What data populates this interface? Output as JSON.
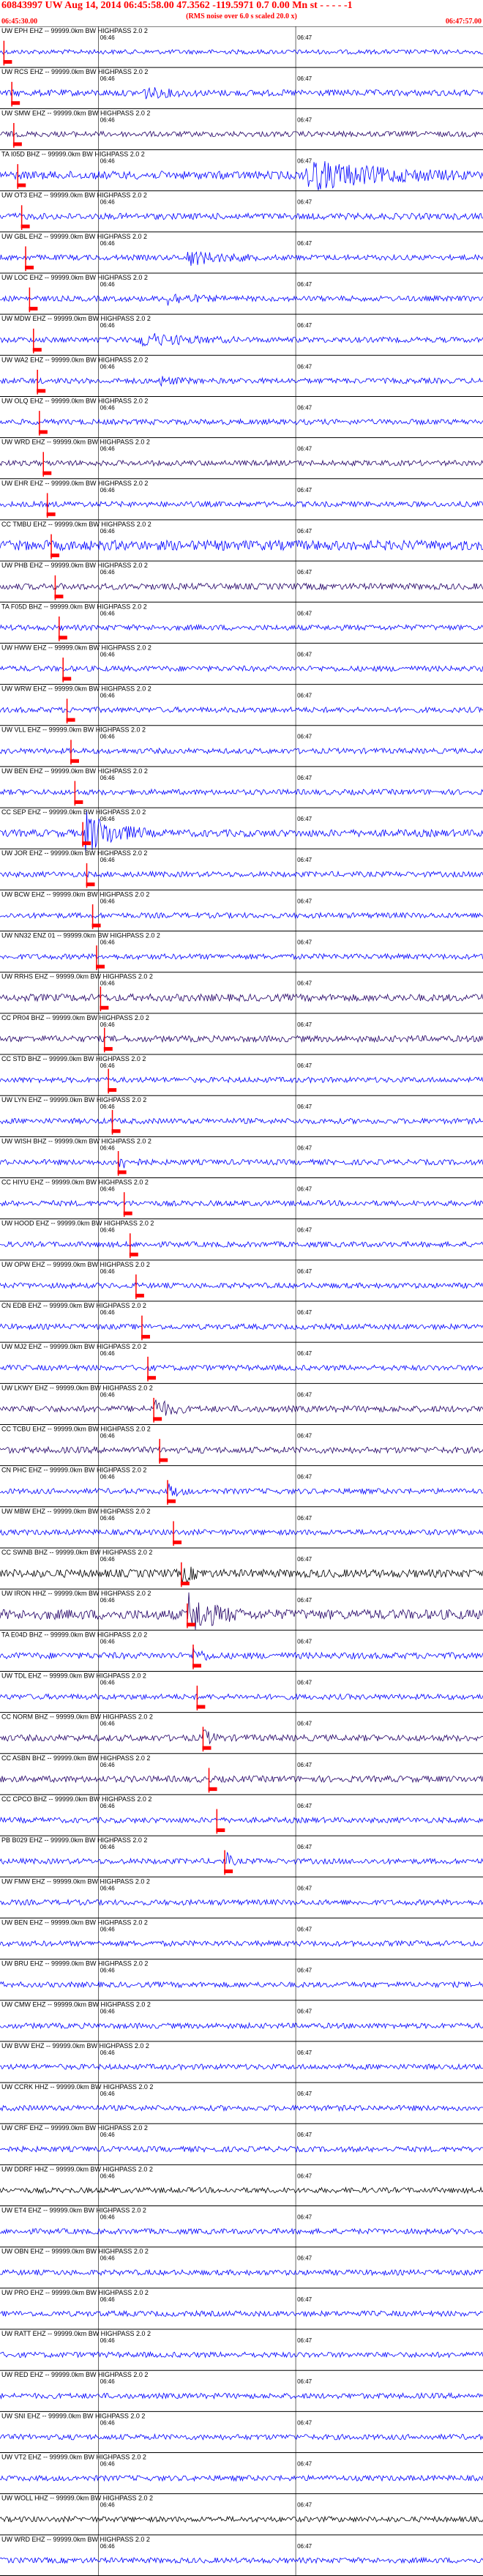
{
  "header": {
    "title": "60843997 UW Aug 14, 2014 06:45:58.00   47.3562  -119.5971   0.7  0.00  Mn st  - - - -  -1",
    "subtitle": "(RMS noise over 6.0 s scaled 20.0 x)",
    "start_time": "06:45:30.00",
    "end_time": "06:47:57.00"
  },
  "colors": {
    "accent": "#ff0000",
    "blue": "#0000ff",
    "dark": "#220066",
    "black": "#000000"
  },
  "chart_data": {
    "type": "line",
    "title": "60843997 UW Aug 14, 2014 06:45:58.00   47.3562  -119.5971   0.7  0.00  Mn st  - - - -  -1",
    "time_range": [
      "06:45:30.00",
      "06:47:57.00"
    ],
    "tick_labels": [
      "06:46",
      "06:47"
    ],
    "tick_minutes": [
      0.5,
      1.5
    ],
    "grid": true,
    "filter_label": "99999.0km BW HIGHPASS 2.0 2",
    "series": [
      {
        "name": "UW EPH EHZ",
        "label": "UW EPH EHZ -- 99999.0km BW HIGHPASS 2.0 2",
        "color": "#0000ff",
        "pick_min": 0.02,
        "noise": 0.25,
        "burst_start": null,
        "burst_end": null,
        "burst_amp": 0
      },
      {
        "name": "UW RCS EHZ",
        "label": "UW RCS EHZ -- 99999.0km BW HIGHPASS 2.0 2",
        "color": "#0000ff",
        "pick_min": 0.06,
        "noise": 0.35,
        "burst_start": 0.72,
        "burst_end": 1.0,
        "burst_amp": 0.5
      },
      {
        "name": "UW SMW EHZ",
        "label": "UW SMW EHZ -- 99999.0km BW HIGHPASS 2.0 2",
        "color": "#220066",
        "pick_min": 0.07,
        "noise": 0.3,
        "burst_start": null,
        "burst_end": null,
        "burst_amp": 0
      },
      {
        "name": "TA I05D BHZ",
        "label": "TA I05D BHZ -- 99999.0km BW HIGHPASS 2.0 2",
        "color": "#0000ff",
        "pick_min": 0.09,
        "noise": 0.45,
        "burst_start": 1.55,
        "burst_end": 2.35,
        "burst_amp": 1.6
      },
      {
        "name": "UW OT3 EHZ",
        "label": "UW OT3 EHZ -- 99999.0km BW HIGHPASS 2.0 2",
        "color": "#0000ff",
        "pick_min": 0.11,
        "noise": 0.35,
        "burst_start": null,
        "burst_end": null,
        "burst_amp": 0
      },
      {
        "name": "UW GBL EHZ",
        "label": "UW GBL EHZ -- 99999.0km BW HIGHPASS 2.0 2",
        "color": "#0000ff",
        "pick_min": 0.13,
        "noise": 0.3,
        "burst_start": 0.95,
        "burst_end": 1.3,
        "burst_amp": 0.8
      },
      {
        "name": "UW LOC EHZ",
        "label": "UW LOC EHZ -- 99999.0km BW HIGHPASS 2.0 2",
        "color": "#0000ff",
        "pick_min": 0.15,
        "noise": 0.3,
        "burst_start": 0.85,
        "burst_end": 1.1,
        "burst_amp": 0.6
      },
      {
        "name": "UW MDW EHZ",
        "label": "UW MDW EHZ -- 99999.0km BW HIGHPASS 2.0 2",
        "color": "#0000ff",
        "pick_min": 0.17,
        "noise": 0.3,
        "burst_start": 0.7,
        "burst_end": 1.2,
        "burst_amp": 0.7
      },
      {
        "name": "UW WA2 EHZ",
        "label": "UW WA2 EHZ -- 99999.0km BW HIGHPASS 2.0 2",
        "color": "#0000ff",
        "pick_min": 0.19,
        "noise": 0.3,
        "burst_start": 0.8,
        "burst_end": 1.0,
        "burst_amp": 0.4
      },
      {
        "name": "UW OLQ EHZ",
        "label": "UW OLQ EHZ -- 99999.0km BW HIGHPASS 2.0 2",
        "color": "#0000ff",
        "pick_min": 0.2,
        "noise": 0.3,
        "burst_start": null,
        "burst_end": null,
        "burst_amp": 0
      },
      {
        "name": "UW WRD EHZ",
        "label": "UW WRD EHZ -- 99999.0km BW HIGHPASS 2.0 2",
        "color": "#220066",
        "pick_min": 0.22,
        "noise": 0.3,
        "burst_start": null,
        "burst_end": null,
        "burst_amp": 0
      },
      {
        "name": "UW EHR EHZ",
        "label": "UW EHR EHZ -- 99999.0km BW HIGHPASS 2.0 2",
        "color": "#0000ff",
        "pick_min": 0.24,
        "noise": 0.3,
        "burst_start": null,
        "burst_end": null,
        "burst_amp": 0
      },
      {
        "name": "CC TMBU EHZ",
        "label": "CC TMBU EHZ -- 99999.0km BW HIGHPASS 2.0 2",
        "color": "#0000ff",
        "pick_min": 0.26,
        "noise": 0.55,
        "burst_start": null,
        "burst_end": null,
        "burst_amp": 0
      },
      {
        "name": "UW PHB EHZ",
        "label": "UW PHB EHZ -- 99999.0km BW HIGHPASS 2.0 2",
        "color": "#220066",
        "pick_min": 0.28,
        "noise": 0.35,
        "burst_start": null,
        "burst_end": null,
        "burst_amp": 0
      },
      {
        "name": "TA F05D BHZ",
        "label": "TA F05D BHZ -- 99999.0km BW HIGHPASS 2.0 2",
        "color": "#0000ff",
        "pick_min": 0.3,
        "noise": 0.3,
        "burst_start": null,
        "burst_end": null,
        "burst_amp": 0
      },
      {
        "name": "UW HWW EHZ",
        "label": "UW HWW EHZ -- 99999.0km BW HIGHPASS 2.0 2",
        "color": "#0000ff",
        "pick_min": 0.32,
        "noise": 0.3,
        "burst_start": null,
        "burst_end": null,
        "burst_amp": 0
      },
      {
        "name": "UW WRW EHZ",
        "label": "UW WRW EHZ -- 99999.0km BW HIGHPASS 2.0 2",
        "color": "#0000ff",
        "pick_min": 0.34,
        "noise": 0.3,
        "burst_start": null,
        "burst_end": null,
        "burst_amp": 0
      },
      {
        "name": "UW VLL EHZ",
        "label": "UW VLL EHZ -- 99999.0km BW HIGHPASS 2.0 2",
        "color": "#0000ff",
        "pick_min": 0.36,
        "noise": 0.3,
        "burst_start": null,
        "burst_end": null,
        "burst_amp": 0
      },
      {
        "name": "UW BEN EHZ",
        "label": "UW BEN EHZ -- 99999.0km BW HIGHPASS 2.0 2",
        "color": "#0000ff",
        "pick_min": 0.38,
        "noise": 0.3,
        "burst_start": null,
        "burst_end": null,
        "burst_amp": 0
      },
      {
        "name": "CC SEP EHZ",
        "label": "CC SEP EHZ -- 99999.0km BW HIGHPASS 2.0 2",
        "color": "#0000ff",
        "pick_min": 0.42,
        "noise": 0.4,
        "burst_start": 0.43,
        "burst_end": 0.75,
        "burst_amp": 2.4
      },
      {
        "name": "UW JOR EHZ",
        "label": "UW JOR EHZ -- 99999.0km BW HIGHPASS 2.0 2",
        "color": "#0000ff",
        "pick_min": 0.44,
        "noise": 0.3,
        "burst_start": null,
        "burst_end": null,
        "burst_amp": 0
      },
      {
        "name": "UW BCW EHZ",
        "label": "UW BCW EHZ -- 99999.0km BW HIGHPASS 2.0 2",
        "color": "#0000ff",
        "pick_min": 0.47,
        "noise": 0.3,
        "burst_start": null,
        "burst_end": null,
        "burst_amp": 0
      },
      {
        "name": "UW NN32 ENZ 01",
        "label": "UW NN32 ENZ 01 -- 99999.0km BW HIGHPASS 2.0 2",
        "color": "#0000ff",
        "pick_min": 0.49,
        "noise": 0.3,
        "burst_start": null,
        "burst_end": null,
        "burst_amp": 0
      },
      {
        "name": "UW RRHS EHZ",
        "label": "UW RRHS EHZ -- 99999.0km BW HIGHPASS 2.0 2",
        "color": "#220066",
        "pick_min": 0.51,
        "noise": 0.4,
        "burst_start": null,
        "burst_end": null,
        "burst_amp": 0
      },
      {
        "name": "CC PR04 BHZ",
        "label": "CC PR04 BHZ -- 99999.0km BW HIGHPASS 2.0 2",
        "color": "#220066",
        "pick_min": 0.53,
        "noise": 0.35,
        "burst_start": null,
        "burst_end": null,
        "burst_amp": 0
      },
      {
        "name": "CC STD BHZ",
        "label": "CC STD BHZ -- 99999.0km BW HIGHPASS 2.0 2",
        "color": "#0000ff",
        "pick_min": 0.55,
        "noise": 0.3,
        "burst_start": null,
        "burst_end": null,
        "burst_amp": 0
      },
      {
        "name": "UW LYN EHZ",
        "label": "UW LYN EHZ -- 99999.0km BW HIGHPASS 2.0 2",
        "color": "#0000ff",
        "pick_min": 0.57,
        "noise": 0.3,
        "burst_start": null,
        "burst_end": null,
        "burst_amp": 0
      },
      {
        "name": "UW WISH BHZ",
        "label": "UW WISH BHZ -- 99999.0km BW HIGHPASS 2.0 2",
        "color": "#0000ff",
        "pick_min": 0.6,
        "noise": 0.3,
        "burst_start": 0.6,
        "burst_end": 0.75,
        "burst_amp": 0.7
      },
      {
        "name": "CC HIYU EHZ",
        "label": "CC HIYU EHZ -- 99999.0km BW HIGHPASS 2.0 2",
        "color": "#0000ff",
        "pick_min": 0.63,
        "noise": 0.3,
        "burst_start": null,
        "burst_end": null,
        "burst_amp": 0
      },
      {
        "name": "UW HOOD EHZ",
        "label": "UW HOOD EHZ -- 99999.0km BW HIGHPASS 2.0 2",
        "color": "#0000ff",
        "pick_min": 0.66,
        "noise": 0.3,
        "burst_start": null,
        "burst_end": null,
        "burst_amp": 0
      },
      {
        "name": "UW OPW EHZ",
        "label": "UW OPW EHZ -- 99999.0km BW HIGHPASS 2.0 2",
        "color": "#0000ff",
        "pick_min": 0.69,
        "noise": 0.3,
        "burst_start": null,
        "burst_end": null,
        "burst_amp": 0
      },
      {
        "name": "CN EDB EHZ",
        "label": "CN EDB EHZ -- 99999.0km BW HIGHPASS 2.0 2",
        "color": "#0000ff",
        "pick_min": 0.72,
        "noise": 0.3,
        "burst_start": null,
        "burst_end": null,
        "burst_amp": 0
      },
      {
        "name": "UW MJ2 EHZ",
        "label": "UW MJ2 EHZ -- 99999.0km BW HIGHPASS 2.0 2",
        "color": "#0000ff",
        "pick_min": 0.75,
        "noise": 0.3,
        "burst_start": null,
        "burst_end": null,
        "burst_amp": 0
      },
      {
        "name": "UW LKWY EHZ",
        "label": "UW LKWY EHZ -- 99999.0km BW HIGHPASS 2.0 2",
        "color": "#220066",
        "pick_min": 0.78,
        "noise": 0.35,
        "burst_start": 0.78,
        "burst_end": 0.95,
        "burst_amp": 1.2
      },
      {
        "name": "CC TCBU EHZ",
        "label": "CC TCBU EHZ -- 99999.0km BW HIGHPASS 2.0 2",
        "color": "#220066",
        "pick_min": 0.81,
        "noise": 0.35,
        "burst_start": null,
        "burst_end": null,
        "burst_amp": 0
      },
      {
        "name": "CN PHC EHZ",
        "label": "CN PHC EHZ -- 99999.0km BW HIGHPASS 2.0 2",
        "color": "#0000ff",
        "pick_min": 0.85,
        "noise": 0.3,
        "burst_start": 0.85,
        "burst_end": 0.97,
        "burst_amp": 0.7
      },
      {
        "name": "UW MBW EHZ",
        "label": "UW MBW EHZ -- 99999.0km BW HIGHPASS 2.0 2",
        "color": "#0000ff",
        "pick_min": 0.88,
        "noise": 0.3,
        "burst_start": null,
        "burst_end": null,
        "burst_amp": 0
      },
      {
        "name": "CC SWNB BHZ",
        "label": "CC SWNB BHZ -- 99999.0km BW HIGHPASS 2.0 2",
        "color": "#000000",
        "pick_min": 0.92,
        "noise": 0.45,
        "burst_start": 0.92,
        "burst_end": 1.05,
        "burst_amp": 0.9
      },
      {
        "name": "UW IRON HHZ",
        "label": "UW IRON HHZ -- 99999.0km BW HIGHPASS 2.0 2",
        "color": "#220066",
        "pick_min": 0.95,
        "noise": 0.55,
        "burst_start": 0.95,
        "burst_end": 1.22,
        "burst_amp": 2.2
      },
      {
        "name": "TA E04D BHZ",
        "label": "TA E04D BHZ -- 99999.0km BW HIGHPASS 2.0 2",
        "color": "#0000ff",
        "pick_min": 0.98,
        "noise": 0.35,
        "burst_start": 0.98,
        "burst_end": 1.1,
        "burst_amp": 0.8
      },
      {
        "name": "UW TDL EHZ",
        "label": "UW TDL EHZ -- 99999.0km BW HIGHPASS 2.0 2",
        "color": "#0000ff",
        "pick_min": 1.0,
        "noise": 0.3,
        "burst_start": null,
        "burst_end": null,
        "burst_amp": 0
      },
      {
        "name": "CC NORM BHZ",
        "label": "CC NORM BHZ -- 99999.0km BW HIGHPASS 2.0 2",
        "color": "#220066",
        "pick_min": 1.03,
        "noise": 0.35,
        "burst_start": 1.03,
        "burst_end": 1.12,
        "burst_amp": 0.9
      },
      {
        "name": "CC ASBN BHZ",
        "label": "CC ASBN BHZ -- 99999.0km BW HIGHPASS 2.0 2",
        "color": "#220066",
        "pick_min": 1.06,
        "noise": 0.35,
        "burst_start": null,
        "burst_end": null,
        "burst_amp": 0
      },
      {
        "name": "CC CPCO BHZ",
        "label": "CC CPCO BHZ -- 99999.0km BW HIGHPASS 2.0 2",
        "color": "#0000ff",
        "pick_min": 1.1,
        "noise": 0.3,
        "burst_start": null,
        "burst_end": null,
        "burst_amp": 0
      },
      {
        "name": "PB B029 EHZ",
        "label": "PB B029 EHZ -- 99999.0km BW HIGHPASS 2.0 2",
        "color": "#0000ff",
        "pick_min": 1.14,
        "noise": 0.3,
        "burst_start": 1.14,
        "burst_end": 1.2,
        "burst_amp": 1.2
      },
      {
        "name": "UW FMW EHZ",
        "label": "UW FMW EHZ -- 99999.0km BW HIGHPASS 2.0 2",
        "color": "#0000ff",
        "pick_min": null,
        "noise": 0.3,
        "burst_start": null,
        "burst_end": null,
        "burst_amp": 0
      },
      {
        "name": "UW BEN EHZ",
        "label": "UW BEN EHZ -- 99999.0km BW HIGHPASS 2.0 2",
        "color": "#0000ff",
        "pick_min": null,
        "noise": 0.3,
        "burst_start": null,
        "burst_end": null,
        "burst_amp": 0
      },
      {
        "name": "UW BRU EHZ",
        "label": "UW BRU EHZ -- 99999.0km BW HIGHPASS 2.0 2",
        "color": "#0000ff",
        "pick_min": null,
        "noise": 0.3,
        "burst_start": null,
        "burst_end": null,
        "burst_amp": 0
      },
      {
        "name": "UW CMW EHZ",
        "label": "UW CMW EHZ -- 99999.0km BW HIGHPASS 2.0 2",
        "color": "#0000ff",
        "pick_min": null,
        "noise": 0.3,
        "burst_start": null,
        "burst_end": null,
        "burst_amp": 0
      },
      {
        "name": "UW BVW EHZ",
        "label": "UW BVW EHZ -- 99999.0km BW HIGHPASS 2.0 2",
        "color": "#0000ff",
        "pick_min": null,
        "noise": 0.3,
        "burst_start": null,
        "burst_end": null,
        "burst_amp": 0
      },
      {
        "name": "UW CCRK HHZ",
        "label": "UW CCRK HHZ -- 99999.0km BW HIGHPASS 2.0 2",
        "color": "#0000ff",
        "pick_min": null,
        "noise": 0.3,
        "burst_start": null,
        "burst_end": null,
        "burst_amp": 0
      },
      {
        "name": "UW CRF EHZ",
        "label": "UW CRF EHZ -- 99999.0km BW HIGHPASS 2.0 2",
        "color": "#0000ff",
        "pick_min": null,
        "noise": 0.3,
        "burst_start": null,
        "burst_end": null,
        "burst_amp": 0
      },
      {
        "name": "UW DDRF HHZ",
        "label": "UW DDRF HHZ -- 99999.0km BW HIGHPASS 2.0 2",
        "color": "#000000",
        "pick_min": null,
        "noise": 0.3,
        "burst_start": null,
        "burst_end": null,
        "burst_amp": 0
      },
      {
        "name": "UW ET4 EHZ",
        "label": "UW ET4 EHZ -- 99999.0km BW HIGHPASS 2.0 2",
        "color": "#0000ff",
        "pick_min": null,
        "noise": 0.3,
        "burst_start": null,
        "burst_end": null,
        "burst_amp": 0
      },
      {
        "name": "UW OBN EHZ",
        "label": "UW OBN EHZ -- 99999.0km BW HIGHPASS 2.0 2",
        "color": "#0000ff",
        "pick_min": null,
        "noise": 0.3,
        "burst_start": null,
        "burst_end": null,
        "burst_amp": 0
      },
      {
        "name": "UW PRO EHZ",
        "label": "UW PRO EHZ -- 99999.0km BW HIGHPASS 2.0 2",
        "color": "#0000ff",
        "pick_min": null,
        "noise": 0.3,
        "burst_start": null,
        "burst_end": null,
        "burst_amp": 0
      },
      {
        "name": "UW RATT EHZ",
        "label": "UW RATT EHZ -- 99999.0km BW HIGHPASS 2.0 2",
        "color": "#0000ff",
        "pick_min": null,
        "noise": 0.3,
        "burst_start": null,
        "burst_end": null,
        "burst_amp": 0
      },
      {
        "name": "UW RED EHZ",
        "label": "UW RED EHZ -- 99999.0km BW HIGHPASS 2.0 2",
        "color": "#0000ff",
        "pick_min": null,
        "noise": 0.3,
        "burst_start": null,
        "burst_end": null,
        "burst_amp": 0
      },
      {
        "name": "UW SNI EHZ",
        "label": "UW SNI EHZ -- 99999.0km BW HIGHPASS 2.0 2",
        "color": "#0000ff",
        "pick_min": null,
        "noise": 0.3,
        "burst_start": null,
        "burst_end": null,
        "burst_amp": 0
      },
      {
        "name": "UW VT2 EHZ",
        "label": "UW VT2 EHZ -- 99999.0km BW HIGHPASS 2.0 2",
        "color": "#0000ff",
        "pick_min": null,
        "noise": 0.3,
        "burst_start": null,
        "burst_end": null,
        "burst_amp": 0
      },
      {
        "name": "UW WOLL HHZ",
        "label": "UW WOLL HHZ -- 99999.0km BW HIGHPASS 2.0 2",
        "color": "#000000",
        "pick_min": null,
        "noise": 0.3,
        "burst_start": null,
        "burst_end": null,
        "burst_amp": 0
      },
      {
        "name": "UW WRD EHZ",
        "label": "UW WRD EHZ -- 99999.0km BW HIGHPASS 2.0 2",
        "color": "#0000ff",
        "pick_min": null,
        "noise": 0.3,
        "burst_start": null,
        "burst_end": null,
        "burst_amp": 0
      }
    ]
  }
}
